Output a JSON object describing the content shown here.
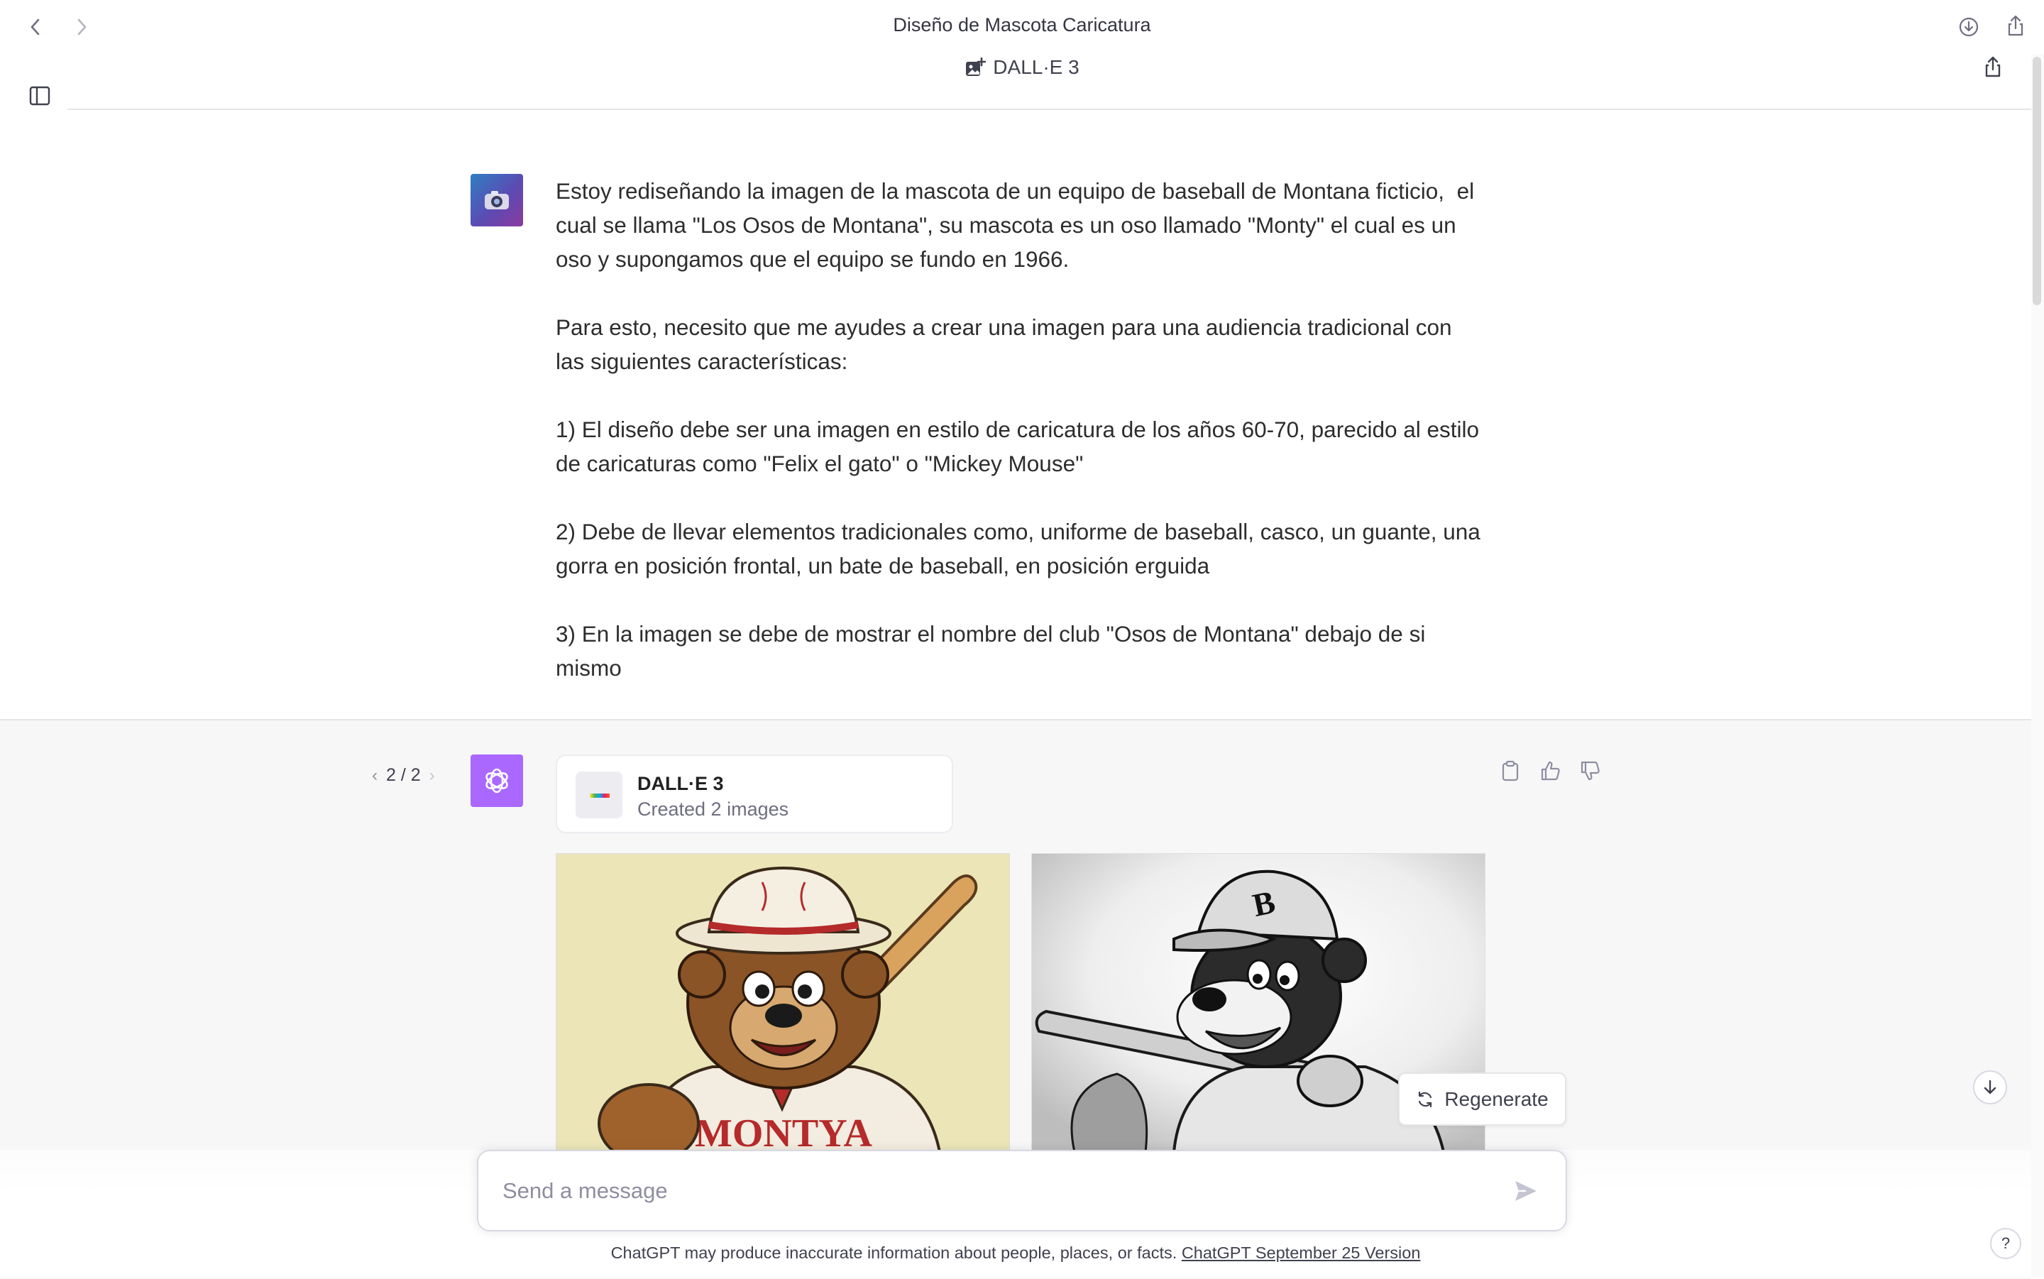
{
  "window": {
    "title": "Diseño de Mascota Caricatura"
  },
  "header": {
    "model_label": "DALL·E 3"
  },
  "user_message": {
    "paragraphs": [
      "Estoy rediseñando la imagen de la mascota de un equipo de baseball de Montana ficticio,  el cual se llama \"Los Osos de Montana\", su mascota es un oso llamado \"Monty\" el cual es un oso y supongamos que el equipo se fundo en 1966.",
      "Para esto, necesito que me ayudes a crear una imagen para una audiencia tradicional con las siguientes características:",
      "1) El diseño debe ser una imagen en estilo de caricatura de los años 60-70, parecido al estilo de caricaturas como \"Felix el gato\" o \"Mickey Mouse\"",
      "2) Debe de llevar elementos tradicionales como, uniforme de baseball, casco, un guante, una gorra en posición frontal, un bate de baseball, en posición erguida",
      "3) En la imagen se debe de mostrar el nombre del club \"Osos de Montana\" debajo de si mismo"
    ]
  },
  "assistant_message": {
    "pager": {
      "current": "2",
      "total": "2",
      "label": "2 / 2"
    },
    "tool_card": {
      "name": "DALL·E 3",
      "subtitle": "Created 2 images"
    },
    "images": [
      {
        "jersey_text": "MONTYA"
      },
      {
        "cap_letter": "B"
      }
    ],
    "regenerate_label": "Regenerate"
  },
  "composer": {
    "placeholder": "Send a message"
  },
  "footer": {
    "disclaimer": "ChatGPT may produce inaccurate information about people, places, or facts.",
    "version_link": "ChatGPT September 25 Version",
    "help_label": "?"
  },
  "colors": {
    "gpt_avatar": "#ab68ff",
    "assistant_bg": "#f7f7f8"
  },
  "icons": [
    "back-arrow-icon",
    "forward-arrow-icon",
    "download-icon",
    "share-icon",
    "sidebar-toggle-icon",
    "image-edit-icon",
    "clipboard-icon",
    "thumbs-up-icon",
    "thumbs-down-icon",
    "refresh-icon",
    "send-icon",
    "arrow-down-icon"
  ]
}
